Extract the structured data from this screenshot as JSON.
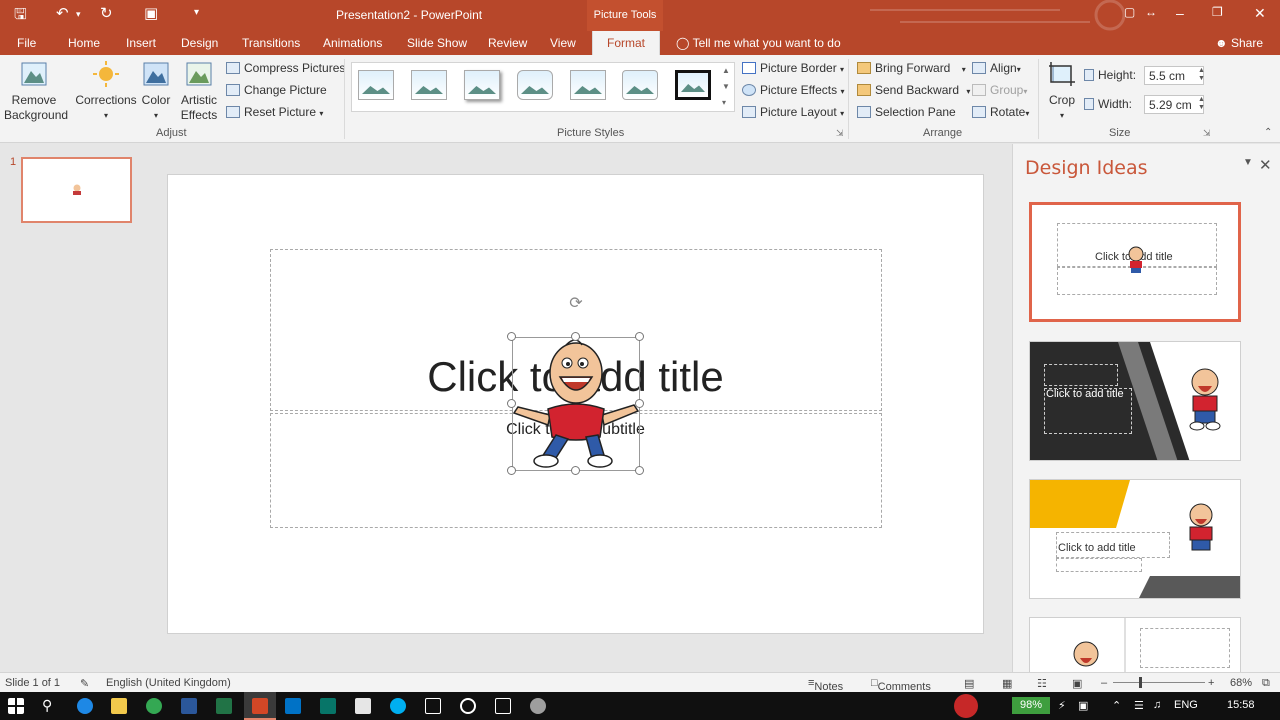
{
  "titlebar": {
    "title": "Presentation2 - PowerPoint",
    "context_tab": "Picture Tools"
  },
  "tabs": [
    {
      "label": "File"
    },
    {
      "label": "Home"
    },
    {
      "label": "Insert"
    },
    {
      "label": "Design"
    },
    {
      "label": "Transitions"
    },
    {
      "label": "Animations"
    },
    {
      "label": "Slide Show"
    },
    {
      "label": "Review"
    },
    {
      "label": "View"
    },
    {
      "label": "Format"
    }
  ],
  "tell_me": "Tell me what you want to do",
  "share": "Share",
  "ribbon": {
    "adjust": {
      "remove_bg_line1": "Remove",
      "remove_bg_line2": "Background",
      "corrections": "Corrections",
      "color": "Color",
      "artistic_line1": "Artistic",
      "artistic_line2": "Effects",
      "compress": "Compress Pictures",
      "change": "Change Picture",
      "reset": "Reset Picture",
      "label": "Adjust"
    },
    "styles": {
      "border": "Picture Border",
      "effects": "Picture Effects",
      "layout": "Picture Layout",
      "label": "Picture Styles"
    },
    "arrange": {
      "bring_forward": "Bring Forward",
      "send_backward": "Send Backward",
      "selection_pane": "Selection Pane",
      "align": "Align",
      "group": "Group",
      "rotate": "Rotate",
      "label": "Arrange"
    },
    "size": {
      "crop": "Crop",
      "height_label": "Height:",
      "height_value": "5.5 cm",
      "width_label": "Width:",
      "width_value": "5.29 cm",
      "label": "Size"
    }
  },
  "thumbnails": {
    "slide_number": "1"
  },
  "slide": {
    "title": "Click to add title",
    "subtitle": "Click to add subtitle"
  },
  "design_ideas": {
    "heading": "Design Ideas",
    "idea1_text": "Click to add title",
    "idea2_text": "Click to add title",
    "idea3_text": "Click to add title",
    "accent_orange": "#f5b400",
    "accent_dark": "#2b2b2b"
  },
  "status": {
    "slide_info": "Slide 1 of 1",
    "language": "English (United Kingdom)",
    "notes": "Notes",
    "comments": "Comments",
    "zoom": "68%"
  },
  "taskbar": {
    "battery": "98%",
    "lang": "ENG",
    "time": "15:58"
  },
  "colors": {
    "brand": "#b7472a",
    "selection": "#e0644a"
  }
}
